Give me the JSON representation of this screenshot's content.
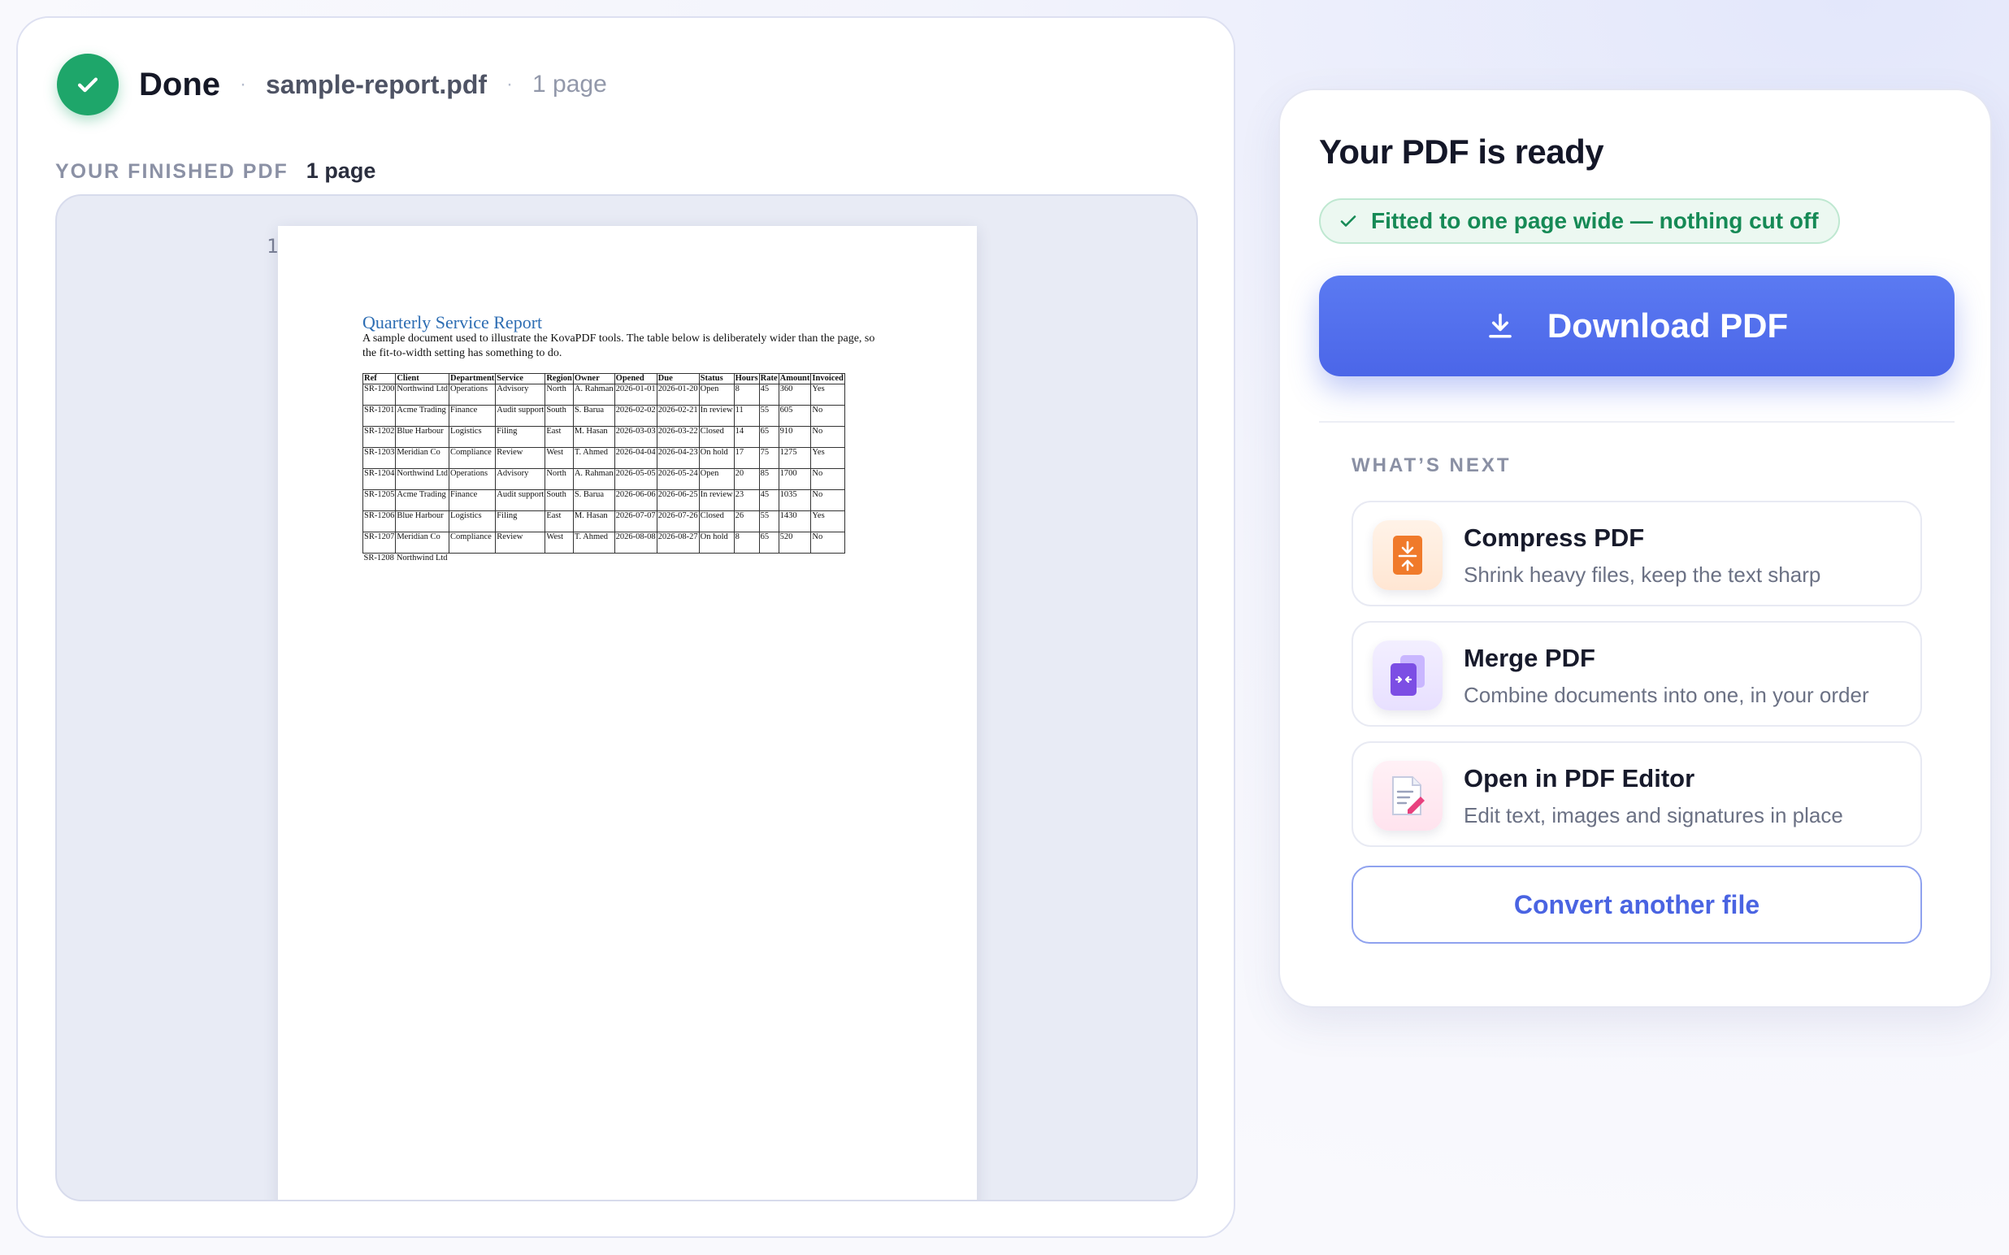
{
  "status": {
    "label": "Done",
    "file_name": "sample-report.pdf",
    "page_count": "1 page",
    "separator": "·"
  },
  "preview": {
    "section_label": "YOUR FINISHED PDF",
    "section_pages": "1 page",
    "page_number": "1",
    "document": {
      "title": "Quarterly Service Report",
      "description": "A sample document used to illustrate the KovaPDF tools. The table below is deliberately wider than the page, so the fit-to-width setting has something to do.",
      "columns": [
        "Ref",
        "Client",
        "Department",
        "Service",
        "Region",
        "Owner",
        "Opened",
        "Due",
        "Status",
        "Hours",
        "Rate",
        "Amount",
        "Invoiced"
      ],
      "rows": [
        [
          "SR-1200",
          "Northwind Ltd",
          "Operations",
          "Advisory",
          "North",
          "A. Rahman",
          "2026-01-01",
          "2026-01-20",
          "Open",
          "8",
          "45",
          "360",
          "Yes"
        ],
        [
          "SR-1201",
          "Acme Trading",
          "Finance",
          "Audit support",
          "South",
          "S. Barua",
          "2026-02-02",
          "2026-02-21",
          "In review",
          "11",
          "55",
          "605",
          "No"
        ],
        [
          "SR-1202",
          "Blue Harbour",
          "Logistics",
          "Filing",
          "East",
          "M. Hasan",
          "2026-03-03",
          "2026-03-22",
          "Closed",
          "14",
          "65",
          "910",
          "No"
        ],
        [
          "SR-1203",
          "Meridian Co",
          "Compliance",
          "Review",
          "West",
          "T. Ahmed",
          "2026-04-04",
          "2026-04-23",
          "On hold",
          "17",
          "75",
          "1275",
          "Yes"
        ],
        [
          "SR-1204",
          "Northwind Ltd",
          "Operations",
          "Advisory",
          "North",
          "A. Rahman",
          "2026-05-05",
          "2026-05-24",
          "Open",
          "20",
          "85",
          "1700",
          "No"
        ],
        [
          "SR-1205",
          "Acme Trading",
          "Finance",
          "Audit support",
          "South",
          "S. Barua",
          "2026-06-06",
          "2026-06-25",
          "In review",
          "23",
          "45",
          "1035",
          "No"
        ],
        [
          "SR-1206",
          "Blue Harbour",
          "Logistics",
          "Filing",
          "East",
          "M. Hasan",
          "2026-07-07",
          "2026-07-26",
          "Closed",
          "26",
          "55",
          "1430",
          "Yes"
        ],
        [
          "SR-1207",
          "Meridian Co",
          "Compliance",
          "Review",
          "West",
          "T. Ahmed",
          "2026-08-08",
          "2026-08-27",
          "On hold",
          "8",
          "65",
          "520",
          "No"
        ]
      ],
      "overflow_row": [
        "SR-1208",
        "Northwind Ltd"
      ]
    }
  },
  "result": {
    "title": "Your PDF is ready",
    "fit_badge": "Fitted to one page wide — nothing cut off",
    "download_label": "Download PDF",
    "next_label": "WHAT’S NEXT",
    "actions": [
      {
        "title": "Compress PDF",
        "subtitle": "Shrink heavy files, keep the text sharp",
        "icon": "compress-icon"
      },
      {
        "title": "Merge PDF",
        "subtitle": "Combine documents into one, in your order",
        "icon": "merge-icon"
      },
      {
        "title": "Open in PDF Editor",
        "subtitle": "Edit text, images and signatures in place",
        "icon": "edit-icon"
      }
    ],
    "convert_label": "Convert another file"
  },
  "colors": {
    "success": "#1ea66a",
    "primary": "#4b66e8",
    "doc_title": "#2d6db3"
  }
}
